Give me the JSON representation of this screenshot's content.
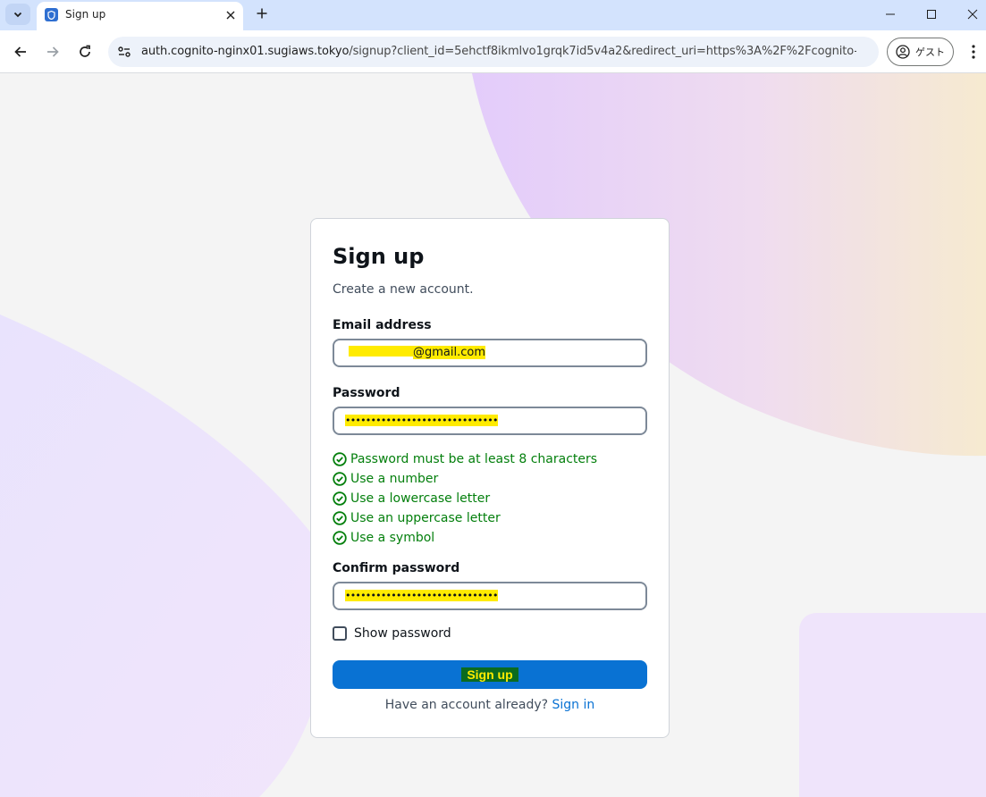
{
  "browser": {
    "tab": {
      "title": "Sign up"
    },
    "url": {
      "host": "auth.cognito-nginx01.sugiaws.tokyo",
      "path": "/signup?client_id=5ehctf8ikmlvo1grqk7id5v4a2&redirect_uri=https%3A%2F%2Fcognito-ngi..."
    },
    "profile": {
      "label": "ゲスト"
    }
  },
  "form": {
    "title": "Sign up",
    "subtitle": "Create a new account.",
    "email": {
      "label": "Email address",
      "value": "@gmail.com"
    },
    "password": {
      "label": "Password",
      "value": "••••••••••••••••••••••••••••••"
    },
    "requirements": [
      "Password must be at least 8 characters",
      "Use a number",
      "Use a lowercase letter",
      "Use an uppercase letter",
      "Use a symbol"
    ],
    "confirm": {
      "label": "Confirm password",
      "value": "••••••••••••••••••••••••••••••"
    },
    "show_password": "Show password",
    "submit": "Sign up",
    "have_account": "Have an account already?",
    "sign_in": "Sign in"
  },
  "colors": {
    "accent": "#0972d3",
    "success": "#037f0c",
    "highlight": "#ffeb00"
  }
}
